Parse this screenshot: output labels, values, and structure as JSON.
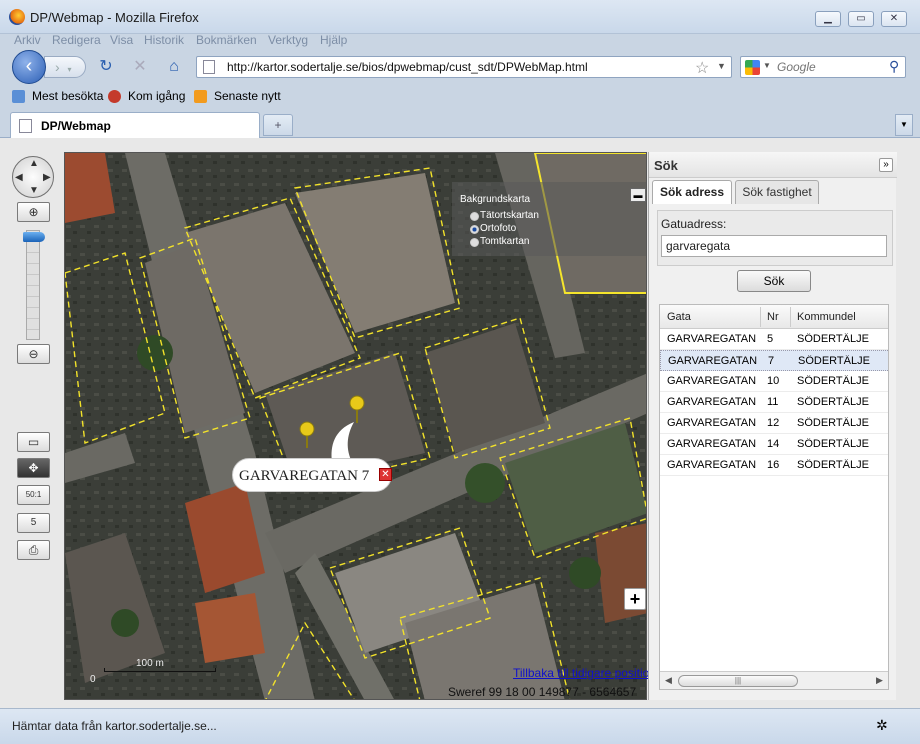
{
  "window": {
    "title": "DP/Webmap - Mozilla Firefox"
  },
  "menu": [
    "Arkiv",
    "Redigera",
    "Visa",
    "Historik",
    "Bokmärken",
    "Verktyg",
    "Hjälp"
  ],
  "nav": {
    "url": "http://kartor.sodertalje.se/bios/dpwebmap/cust_sdt/DPWebMap.html",
    "search_placeholder": "Google"
  },
  "bookmarks": [
    "Mest besökta",
    "Kom igång",
    "Senaste nytt"
  ],
  "tab": {
    "title": "DP/Webmap"
  },
  "map": {
    "layers_title": "Bakgrundskarta",
    "layers": [
      {
        "label": "Tätortskartan",
        "selected": false
      },
      {
        "label": "Ortofoto",
        "selected": true
      },
      {
        "label": "Tomtkartan",
        "selected": false
      }
    ],
    "popup_text": "GARVAREGATAN 7",
    "back_link": "Tillbaka till tidigare position",
    "coords": "Sweref 99 18 00 149877 - 6564657",
    "scale_unit": "100 m",
    "scale_zero": "0",
    "zoom_level_fraction": 0.98
  },
  "panel": {
    "title": "Sök",
    "tabs": [
      "Sök adress",
      "Sök fastighet"
    ],
    "field_label": "Gatuadress:",
    "field_value": "garvaregata",
    "search_button": "Sök",
    "columns": [
      "Gata",
      "Nr",
      "Kommundel"
    ],
    "rows": [
      [
        "GARVAREGATAN",
        "5",
        "SÖDERTÄLJE"
      ],
      [
        "GARVAREGATAN",
        "7",
        "SÖDERTÄLJE"
      ],
      [
        "GARVAREGATAN",
        "10",
        "SÖDERTÄLJE"
      ],
      [
        "GARVAREGATAN",
        "11",
        "SÖDERTÄLJE"
      ],
      [
        "GARVAREGATAN",
        "12",
        "SÖDERTÄLJE"
      ],
      [
        "GARVAREGATAN",
        "14",
        "SÖDERTÄLJE"
      ],
      [
        "GARVAREGATAN",
        "16",
        "SÖDERTÄLJE"
      ]
    ],
    "selected_row": 1
  },
  "status": {
    "text": "Hämtar data från kartor.sodertalje.se..."
  }
}
